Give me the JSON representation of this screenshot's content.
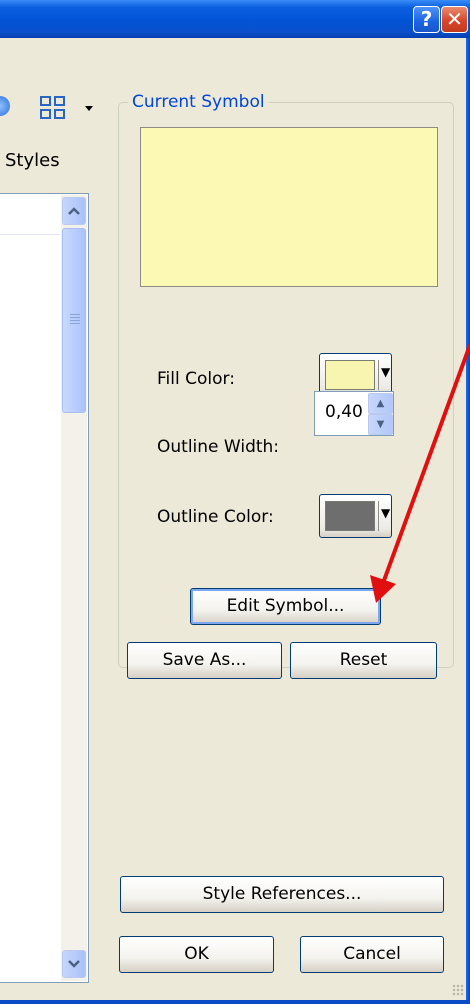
{
  "window": {
    "help_label": "?",
    "close_label": "✕"
  },
  "styles_label": "Styles",
  "current_symbol": {
    "title": "Current Symbol",
    "preview_fill": "#fbf9b4",
    "fill_color_label": "Fill Color:",
    "fill_color_value": "#f8f5b0",
    "outline_width_label": "Outline Width:",
    "outline_width_value": "0,40",
    "outline_color_label": "Outline Color:",
    "outline_color_value": "#6e6e6e",
    "edit_symbol_label": "Edit Symbol...",
    "save_as_label": "Save As...",
    "reset_label": "Reset"
  },
  "footer": {
    "style_references_label": "Style References...",
    "ok_label": "OK",
    "cancel_label": "Cancel"
  },
  "icons": [
    "help-icon",
    "close-icon",
    "view-options-icon",
    "scroll-up-icon",
    "scroll-down-icon",
    "dropdown-arrow-icon",
    "spin-up-icon",
    "spin-down-icon"
  ],
  "annotation_color": "#e01010"
}
